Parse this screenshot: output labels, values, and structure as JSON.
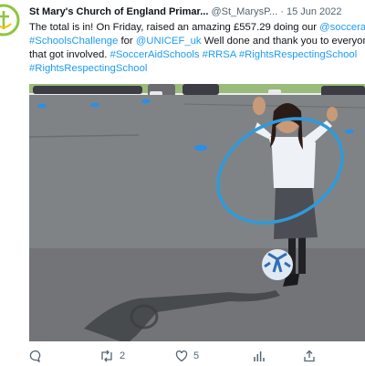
{
  "tweet": {
    "author_name": "St Mary's Church of England Primar...",
    "handle": "@St_MarysP...",
    "separator": "·",
    "date": "15 Jun 2022",
    "lines": [
      [
        {
          "text": "The total is in! On Friday, raised an amazing £557.29 doing our ",
          "link": false
        },
        {
          "text": "@soccera",
          "link": true
        }
      ],
      [
        {
          "text": "#SchoolsChallenge",
          "link": true
        },
        {
          "text": " for ",
          "link": false
        },
        {
          "text": "@UNICEF_uk",
          "link": true
        },
        {
          "text": " Well done and thank you to everyon",
          "link": false
        }
      ],
      [
        {
          "text": "that got involved. ",
          "link": false
        },
        {
          "text": "#SoccerAidSchools #RRSA #RightsRespectingSchool",
          "link": true
        }
      ],
      [
        {
          "text": "#RightsRespectingSchool",
          "link": true
        }
      ]
    ],
    "media_alt_icon": "photo-girl-hula-hoop-football-playground"
  },
  "actions": {
    "reply": {
      "icon": "reply-icon",
      "count": ""
    },
    "retweet": {
      "icon": "retweet-icon",
      "count": "2"
    },
    "like": {
      "icon": "heart-icon",
      "count": "5"
    },
    "views": {
      "icon": "analytics-icon",
      "count": ""
    },
    "share": {
      "icon": "share-icon",
      "count": ""
    }
  },
  "colors": {
    "link": "#1d9bf0",
    "text": "#0f1419",
    "muted": "#536471",
    "logo_green": "#8cc63f"
  }
}
